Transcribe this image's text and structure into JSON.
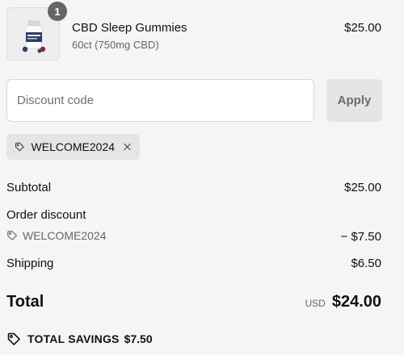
{
  "product": {
    "quantity": "1",
    "name": "CBD Sleep Gummies",
    "variant": "60ct (750mg CBD)",
    "price": "$25.00",
    "image_icon": "gummy-bottle-icon"
  },
  "discount": {
    "placeholder": "Discount code",
    "value": "",
    "apply_label": "Apply"
  },
  "applied_code": {
    "code": "WELCOME2024",
    "tag_icon": "tag-icon",
    "remove_icon": "close-icon"
  },
  "summary": {
    "subtotal_label": "Subtotal",
    "subtotal_value": "$25.00",
    "order_discount_label": "Order discount",
    "order_discount_code": "WELCOME2024",
    "order_discount_value": "− $7.50",
    "shipping_label": "Shipping",
    "shipping_value": "$6.50",
    "total_label": "Total",
    "currency": "USD",
    "total_value": "$24.00"
  },
  "savings": {
    "label": "TOTAL SAVINGS",
    "amount": "$7.50"
  },
  "colors": {
    "background": "#f5f5f5",
    "chip": "#e5e5e5",
    "badge": "#666666",
    "muted_text": "#666666"
  }
}
